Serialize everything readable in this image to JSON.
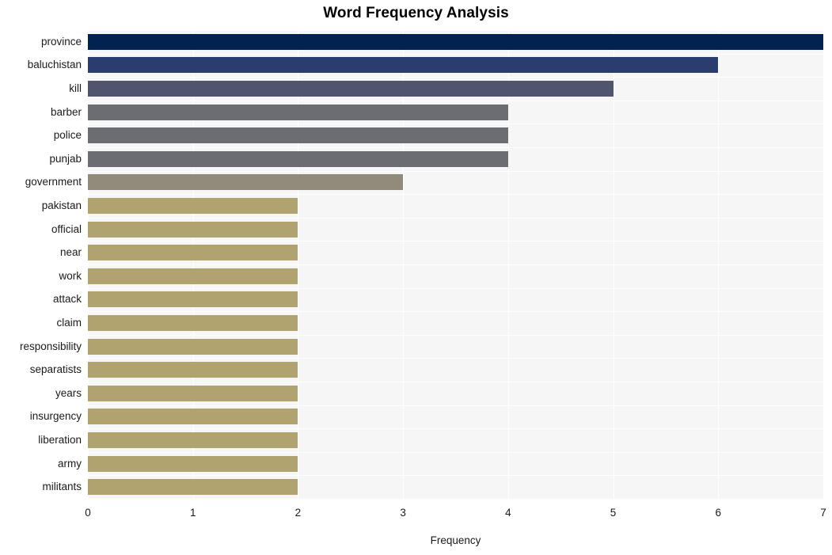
{
  "chart_data": {
    "type": "bar",
    "orientation": "horizontal",
    "title": "Word Frequency Analysis",
    "xlabel": "Frequency",
    "ylabel": "",
    "xlim": [
      0,
      7
    ],
    "xticks": [
      0,
      1,
      2,
      3,
      4,
      5,
      6,
      7
    ],
    "grid": true,
    "legend": false,
    "categories": [
      "province",
      "baluchistan",
      "kill",
      "barber",
      "police",
      "punjab",
      "government",
      "pakistan",
      "official",
      "near",
      "work",
      "attack",
      "claim",
      "responsibility",
      "separatists",
      "years",
      "insurgency",
      "liberation",
      "army",
      "militants"
    ],
    "values": [
      7,
      6,
      5,
      4,
      4,
      4,
      3,
      2,
      2,
      2,
      2,
      2,
      2,
      2,
      2,
      2,
      2,
      2,
      2,
      2
    ],
    "bar_colors": [
      "#022251",
      "#2a3d6e",
      "#4f556e",
      "#6b6d72",
      "#6b6d72",
      "#6b6d72",
      "#918b7c",
      "#b0a370",
      "#b0a370",
      "#b0a370",
      "#b0a370",
      "#b0a370",
      "#b0a370",
      "#b0a370",
      "#b0a370",
      "#b0a370",
      "#b0a370",
      "#b0a370",
      "#b0a370",
      "#b0a370"
    ],
    "plot_background": "#f6f6f6",
    "grid_color": "#ffffff",
    "figure_background": "#ffffff"
  }
}
